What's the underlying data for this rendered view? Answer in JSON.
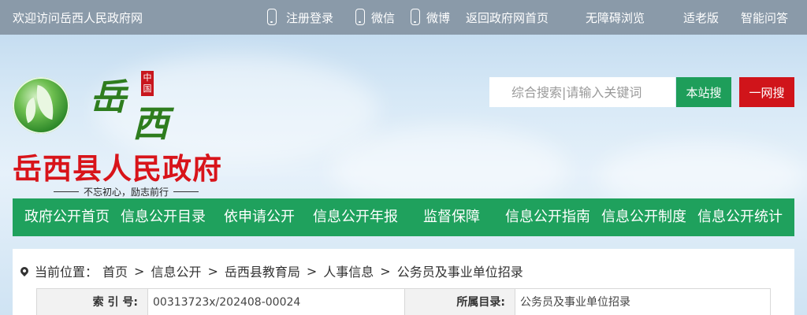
{
  "topbar": {
    "welcome": "欢迎访问岳西人民政府网",
    "links": [
      "注册登录",
      "微信",
      "微博",
      "返回政府网首页",
      "无障碍浏览",
      "适老版",
      "智能问答"
    ]
  },
  "logo": {
    "calligraphy_1": "岳",
    "calligraphy_2": "西",
    "seal": "中国",
    "title": "岳西县人民政府",
    "slogan": "不忘初心，励志前行"
  },
  "search": {
    "placeholder": "综合搜索|请输入关键词",
    "site_button": "本站搜",
    "all_button": "一网搜"
  },
  "nav": [
    "政府公开首页",
    "信息公开目录",
    "依申请公开",
    "信息公开年报",
    "监督保障",
    "信息公开指南",
    "信息公开制度",
    "信息公开统计"
  ],
  "breadcrumb": {
    "label": "当前位置：",
    "items": [
      "首页",
      "信息公开",
      "岳西县教育局",
      "人事信息",
      "公务员及事业单位招录"
    ],
    "separator": ">"
  },
  "meta": {
    "index_label": "索 引 号:",
    "index_value": "00313723x/202408-00024",
    "catalog_label": "所属目录:",
    "catalog_value": "公务员及事业单位招录"
  },
  "colors": {
    "topbar": "#8a9aa9",
    "nav_green": "#1fa15d",
    "title_red": "#d8141a",
    "search_green": "#1e9e5a",
    "search_red": "#d0141a"
  }
}
